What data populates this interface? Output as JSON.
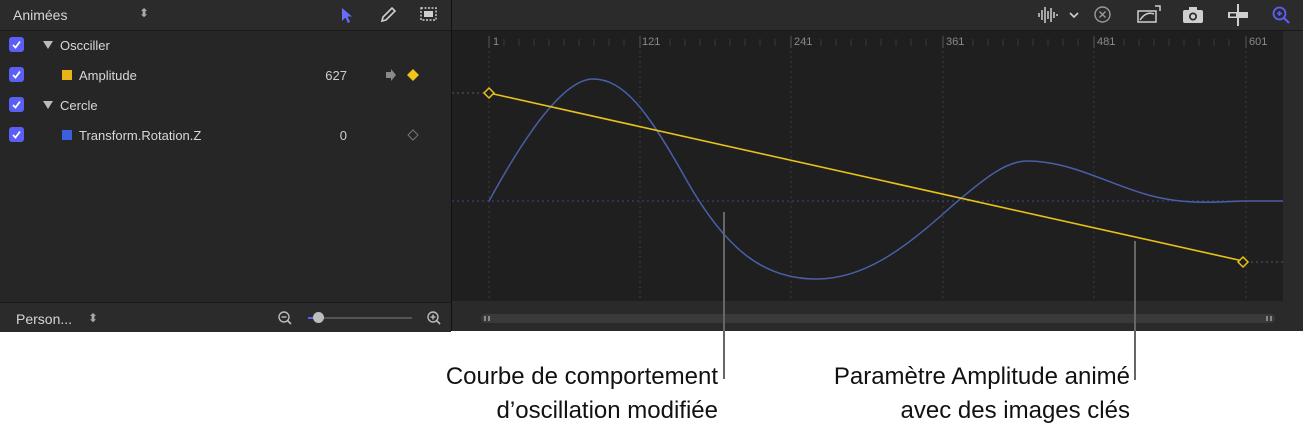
{
  "left_panel": {
    "header_title": "Animées",
    "rows": [
      {
        "label": "Oscciller",
        "type": "group"
      },
      {
        "label": "Amplitude",
        "value": "627",
        "swatch": "#e8b518"
      },
      {
        "label": "Cercle",
        "type": "group"
      },
      {
        "label": "Transform.Rotation.Z",
        "value": "0",
        "swatch": "#3c5fe0"
      }
    ],
    "footer_preset": "Person..."
  },
  "ruler": {
    "ticks": [
      "1",
      "121",
      "241",
      "361",
      "481",
      "601"
    ]
  },
  "callouts": {
    "left_line1": "Courbe de comportement",
    "left_line2": "d’oscillation modifiée",
    "right_line1": "Paramètre Amplitude animé",
    "right_line2": "avec des images clés"
  },
  "colors": {
    "accent": "#5b5ff6",
    "keyframe_yellow": "#e8c21a",
    "curve_blue": "#4a5fa8"
  }
}
